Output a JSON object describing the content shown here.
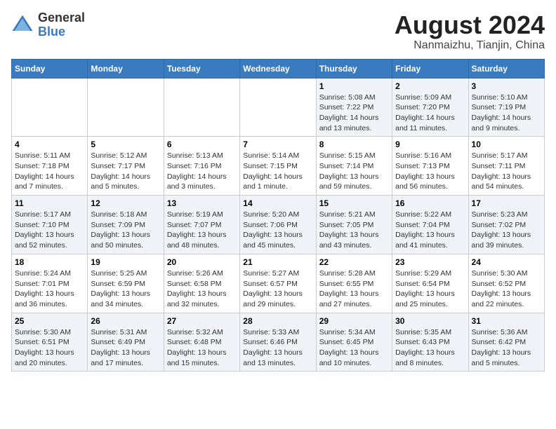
{
  "logo": {
    "general": "General",
    "blue": "Blue"
  },
  "title": "August 2024",
  "subtitle": "Nanmaizhu, Tianjin, China",
  "days_of_week": [
    "Sunday",
    "Monday",
    "Tuesday",
    "Wednesday",
    "Thursday",
    "Friday",
    "Saturday"
  ],
  "weeks": [
    [
      {
        "day": "",
        "info": ""
      },
      {
        "day": "",
        "info": ""
      },
      {
        "day": "",
        "info": ""
      },
      {
        "day": "",
        "info": ""
      },
      {
        "day": "1",
        "info": "Sunrise: 5:08 AM\nSunset: 7:22 PM\nDaylight: 14 hours\nand 13 minutes."
      },
      {
        "day": "2",
        "info": "Sunrise: 5:09 AM\nSunset: 7:20 PM\nDaylight: 14 hours\nand 11 minutes."
      },
      {
        "day": "3",
        "info": "Sunrise: 5:10 AM\nSunset: 7:19 PM\nDaylight: 14 hours\nand 9 minutes."
      }
    ],
    [
      {
        "day": "4",
        "info": "Sunrise: 5:11 AM\nSunset: 7:18 PM\nDaylight: 14 hours\nand 7 minutes."
      },
      {
        "day": "5",
        "info": "Sunrise: 5:12 AM\nSunset: 7:17 PM\nDaylight: 14 hours\nand 5 minutes."
      },
      {
        "day": "6",
        "info": "Sunrise: 5:13 AM\nSunset: 7:16 PM\nDaylight: 14 hours\nand 3 minutes."
      },
      {
        "day": "7",
        "info": "Sunrise: 5:14 AM\nSunset: 7:15 PM\nDaylight: 14 hours\nand 1 minute."
      },
      {
        "day": "8",
        "info": "Sunrise: 5:15 AM\nSunset: 7:14 PM\nDaylight: 13 hours\nand 59 minutes."
      },
      {
        "day": "9",
        "info": "Sunrise: 5:16 AM\nSunset: 7:13 PM\nDaylight: 13 hours\nand 56 minutes."
      },
      {
        "day": "10",
        "info": "Sunrise: 5:17 AM\nSunset: 7:11 PM\nDaylight: 13 hours\nand 54 minutes."
      }
    ],
    [
      {
        "day": "11",
        "info": "Sunrise: 5:17 AM\nSunset: 7:10 PM\nDaylight: 13 hours\nand 52 minutes."
      },
      {
        "day": "12",
        "info": "Sunrise: 5:18 AM\nSunset: 7:09 PM\nDaylight: 13 hours\nand 50 minutes."
      },
      {
        "day": "13",
        "info": "Sunrise: 5:19 AM\nSunset: 7:07 PM\nDaylight: 13 hours\nand 48 minutes."
      },
      {
        "day": "14",
        "info": "Sunrise: 5:20 AM\nSunset: 7:06 PM\nDaylight: 13 hours\nand 45 minutes."
      },
      {
        "day": "15",
        "info": "Sunrise: 5:21 AM\nSunset: 7:05 PM\nDaylight: 13 hours\nand 43 minutes."
      },
      {
        "day": "16",
        "info": "Sunrise: 5:22 AM\nSunset: 7:04 PM\nDaylight: 13 hours\nand 41 minutes."
      },
      {
        "day": "17",
        "info": "Sunrise: 5:23 AM\nSunset: 7:02 PM\nDaylight: 13 hours\nand 39 minutes."
      }
    ],
    [
      {
        "day": "18",
        "info": "Sunrise: 5:24 AM\nSunset: 7:01 PM\nDaylight: 13 hours\nand 36 minutes."
      },
      {
        "day": "19",
        "info": "Sunrise: 5:25 AM\nSunset: 6:59 PM\nDaylight: 13 hours\nand 34 minutes."
      },
      {
        "day": "20",
        "info": "Sunrise: 5:26 AM\nSunset: 6:58 PM\nDaylight: 13 hours\nand 32 minutes."
      },
      {
        "day": "21",
        "info": "Sunrise: 5:27 AM\nSunset: 6:57 PM\nDaylight: 13 hours\nand 29 minutes."
      },
      {
        "day": "22",
        "info": "Sunrise: 5:28 AM\nSunset: 6:55 PM\nDaylight: 13 hours\nand 27 minutes."
      },
      {
        "day": "23",
        "info": "Sunrise: 5:29 AM\nSunset: 6:54 PM\nDaylight: 13 hours\nand 25 minutes."
      },
      {
        "day": "24",
        "info": "Sunrise: 5:30 AM\nSunset: 6:52 PM\nDaylight: 13 hours\nand 22 minutes."
      }
    ],
    [
      {
        "day": "25",
        "info": "Sunrise: 5:30 AM\nSunset: 6:51 PM\nDaylight: 13 hours\nand 20 minutes."
      },
      {
        "day": "26",
        "info": "Sunrise: 5:31 AM\nSunset: 6:49 PM\nDaylight: 13 hours\nand 17 minutes."
      },
      {
        "day": "27",
        "info": "Sunrise: 5:32 AM\nSunset: 6:48 PM\nDaylight: 13 hours\nand 15 minutes."
      },
      {
        "day": "28",
        "info": "Sunrise: 5:33 AM\nSunset: 6:46 PM\nDaylight: 13 hours\nand 13 minutes."
      },
      {
        "day": "29",
        "info": "Sunrise: 5:34 AM\nSunset: 6:45 PM\nDaylight: 13 hours\nand 10 minutes."
      },
      {
        "day": "30",
        "info": "Sunrise: 5:35 AM\nSunset: 6:43 PM\nDaylight: 13 hours\nand 8 minutes."
      },
      {
        "day": "31",
        "info": "Sunrise: 5:36 AM\nSunset: 6:42 PM\nDaylight: 13 hours\nand 5 minutes."
      }
    ]
  ]
}
